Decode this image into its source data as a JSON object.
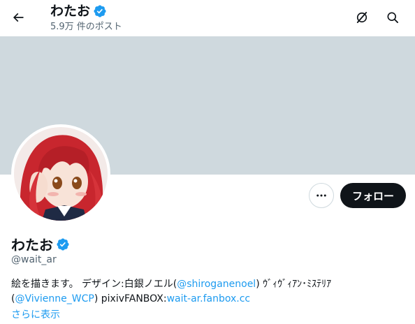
{
  "header": {
    "title": "わたお",
    "post_count": "5.9万 件のポスト"
  },
  "profile": {
    "display_name": "わたお",
    "handle": "@wait_ar",
    "follow_label": "フォロー",
    "bio": {
      "text1": "絵を描きます。 デザイン:白銀ノエル(",
      "mention1": "@shiroganenoel",
      "text2": ") ｳﾞｨｳﾞｨｱﾝ･ﾐｽﾃﾘｱ(",
      "mention2": "@Vivienne_WCP",
      "text3": ") pixivFANBOX:",
      "link": "wait-ar.fanbox.cc"
    },
    "show_more": "さらに表示"
  },
  "icons": {
    "back": "arrow-left-icon",
    "grok": "grok-icon",
    "search": "search-icon",
    "more": "more-horizontal-icon",
    "verified": "verified-badge-icon"
  },
  "colors": {
    "accent": "#1d9bf0",
    "banner": "#cfd9de",
    "follow_bg": "#0f1419"
  }
}
